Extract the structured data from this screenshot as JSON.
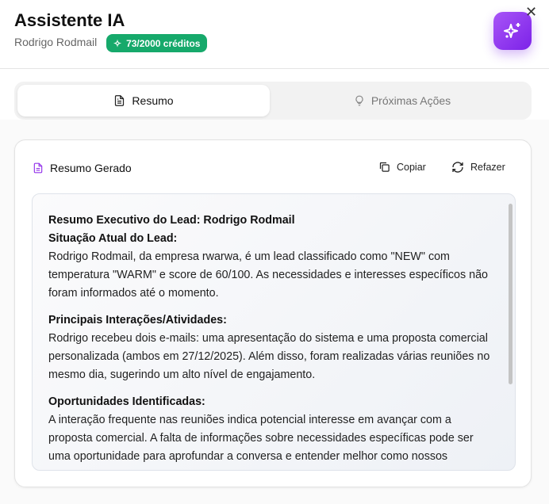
{
  "header": {
    "title": "Assistente IA",
    "lead_name": "Rodrigo Rodmail",
    "credits": "73/2000 créditos",
    "accent": "#16a96b",
    "ai_color": "#9333ea"
  },
  "tabs": [
    {
      "label": "Resumo",
      "icon": "file-text-icon",
      "active": true
    },
    {
      "label": "Próximas Ações",
      "icon": "lightbulb-icon",
      "active": false
    }
  ],
  "card": {
    "title": "Resumo Gerado",
    "copy_label": "Copiar",
    "redo_label": "Refazer"
  },
  "summary": {
    "heading": "Resumo Executivo do Lead: Rodrigo Rodmail",
    "sections": [
      {
        "title": "Situação Atual do Lead:",
        "body": "Rodrigo Rodmail, da empresa rwarwa, é um lead classificado como \"NEW\" com temperatura \"WARM\" e score de 60/100. As necessidades e interesses específicos não foram informados até o momento."
      },
      {
        "title": "Principais Interações/Atividades:",
        "body": "Rodrigo recebeu dois e-mails: uma apresentação do sistema e uma proposta comercial personalizada (ambos em 27/12/2025). Além disso, foram realizadas várias reuniões no mesmo dia, sugerindo um alto nível de engajamento."
      },
      {
        "title": "Oportunidades Identificadas:",
        "body": "A interação frequente nas reuniões indica potencial interesse em avançar com a proposta comercial. A falta de informações sobre necessidades específicas pode ser uma oportunidade para aprofundar a conversa e entender melhor como nossos"
      }
    ]
  }
}
